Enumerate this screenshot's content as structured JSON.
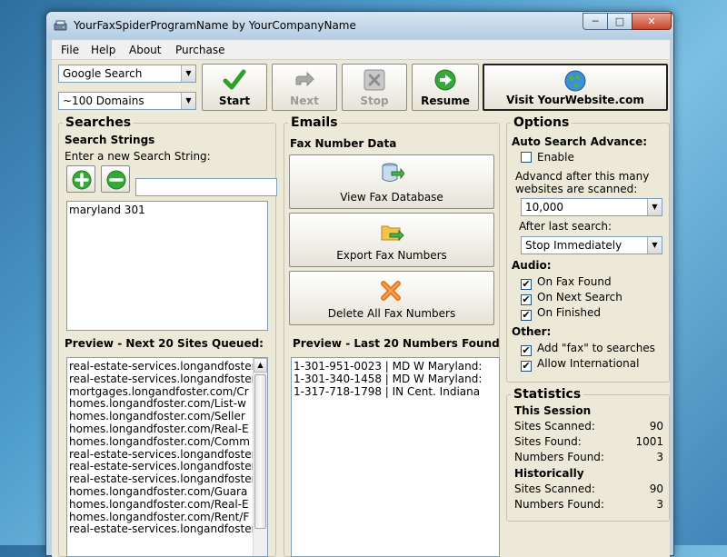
{
  "window": {
    "title": "YourFaxSpiderProgramName by YourCompanyName"
  },
  "menu": [
    "File",
    "Help",
    "About",
    "Purchase"
  ],
  "controls": {
    "search_engine": "Google Search",
    "domain_limit": "~100 Domains"
  },
  "toolbar": {
    "start": "Start",
    "next": "Next",
    "stop": "Stop",
    "resume": "Resume",
    "visit": "Visit YourWebsite.com"
  },
  "searches": {
    "title": "Searches",
    "strings_heading": "Search Strings",
    "prompt": "Enter a new Search String:",
    "input_value": "",
    "items": [
      "maryland 301"
    ],
    "preview_heading": "Preview - Next 20 Sites Queued:",
    "queued_sites": [
      "real-estate-services.longandfoster",
      "real-estate-services.longandfoster",
      "mortgages.longandfoster.com/Cr",
      "homes.longandfoster.com/List-w",
      "homes.longandfoster.com/Seller",
      "homes.longandfoster.com/Real-E",
      "homes.longandfoster.com/Comm",
      "real-estate-services.longandfoster",
      "real-estate-services.longandfoster",
      "real-estate-services.longandfoster",
      "homes.longandfoster.com/Guara",
      "homes.longandfoster.com/Real-E",
      "homes.longandfoster.com/Rent/F",
      "real-estate-services.longandfoster"
    ]
  },
  "emails": {
    "title": "Emails",
    "fax_heading": "Fax Number Data",
    "view_db": "View Fax Database",
    "export": "Export Fax Numbers",
    "delete_all": "Delete All Fax Numbers",
    "preview_heading": "Preview - Last 20 Numbers Found",
    "numbers": [
      "1-301-951-0023 | MD  W Maryland:",
      "1-301-340-1458 | MD  W Maryland:",
      "1-317-718-1798 | IN  Cent. Indiana"
    ]
  },
  "options": {
    "title": "Options",
    "auto_heading": "Auto Search Advance:",
    "enable_label": "Enable",
    "enable_checked": false,
    "advance_text_1": "Advancd after this many",
    "advance_text_2": "websites are scanned:",
    "advance_value": "10,000",
    "after_last_label": "After last search:",
    "after_last_value": "Stop Immediately",
    "audio_heading": "Audio:",
    "audio": [
      {
        "label": "On Fax Found",
        "checked": true
      },
      {
        "label": "On Next Search",
        "checked": true
      },
      {
        "label": "On Finished",
        "checked": true
      }
    ],
    "other_heading": "Other:",
    "other": [
      {
        "label": "Add \"fax\" to searches",
        "checked": true
      },
      {
        "label": "Allow International",
        "checked": true
      }
    ]
  },
  "statistics": {
    "title": "Statistics",
    "session_heading": "This Session",
    "sites_scanned_label": "Sites Scanned:",
    "sites_scanned": "90",
    "sites_found_label": "Sites Found:",
    "sites_found": "1001",
    "numbers_found_label": "Numbers Found:",
    "numbers_found": "3",
    "hist_heading": "Historically",
    "hist_sites_scanned_label": "Sites Scanned:",
    "hist_sites_scanned": "90",
    "hist_numbers_found_label": "Numbers Found:",
    "hist_numbers_found": "3"
  },
  "icons": {
    "app": "fax-spider-icon",
    "start": "checkmark-icon",
    "next": "next-arrow-icon",
    "stop": "stop-x-icon",
    "resume": "resume-arrow-icon",
    "visit": "globe-icon",
    "add": "plus-icon",
    "remove": "minus-icon",
    "view_db": "database-icon",
    "export": "folder-export-icon",
    "delete": "delete-x-icon"
  },
  "colors": {
    "accent_green": "#2e9e2e",
    "delete_orange": "#e8791e",
    "window_face": "#ece9d8"
  }
}
